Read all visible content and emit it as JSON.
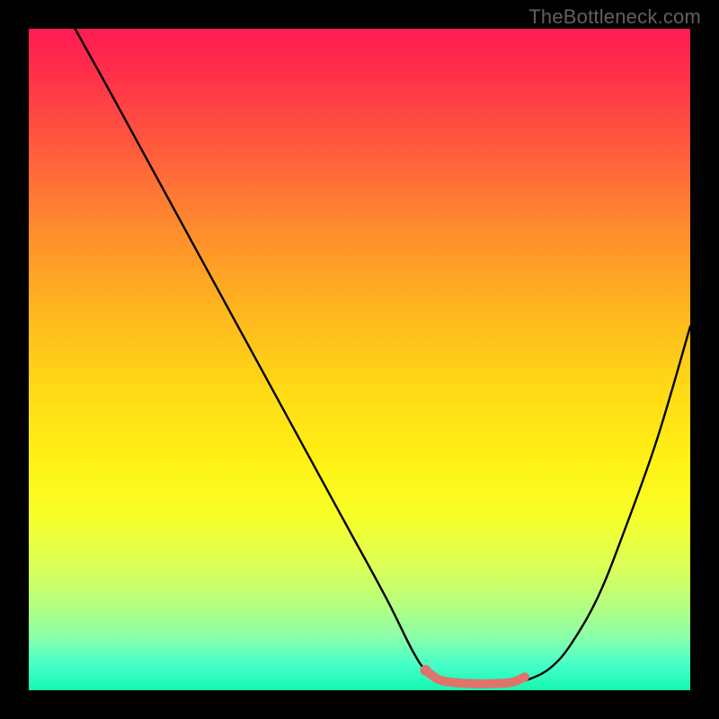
{
  "watermark": "TheBottleneck.com",
  "chart_data": {
    "type": "line",
    "title": "",
    "xlabel": "",
    "ylabel": "",
    "xlim": [
      0,
      100
    ],
    "ylim": [
      0,
      100
    ],
    "series": [
      {
        "name": "black-curve",
        "color": "#000000",
        "x": [
          7,
          12,
          18,
          24,
          30,
          36,
          42,
          48,
          54,
          58,
          60,
          62,
          64,
          67,
          70,
          73,
          76,
          79,
          82,
          86,
          90,
          95,
          100
        ],
        "y": [
          100,
          91,
          80,
          69,
          58,
          47,
          36,
          25,
          14,
          6,
          3,
          1.5,
          1.1,
          1.0,
          1.0,
          1.1,
          1.8,
          3.5,
          7,
          14,
          24,
          38,
          55
        ]
      },
      {
        "name": "pink-segment",
        "color": "#e0736b",
        "x": [
          60,
          62,
          64,
          67,
          70,
          73,
          75
        ],
        "y": [
          3.0,
          1.6,
          1.2,
          1.0,
          1.0,
          1.2,
          2.0
        ]
      }
    ],
    "annotations": []
  }
}
